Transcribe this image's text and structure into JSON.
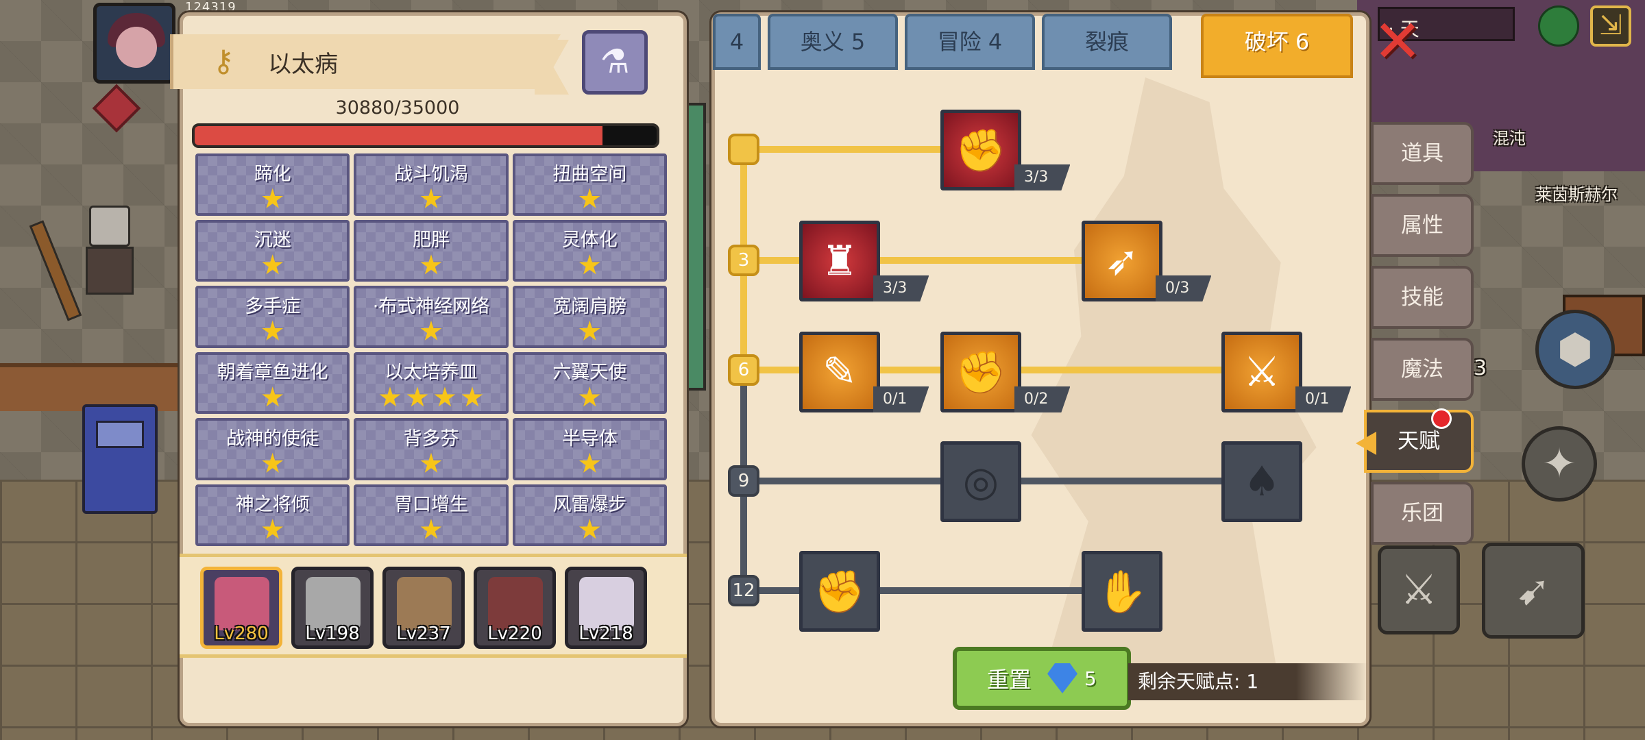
{
  "hud": {
    "stats_text": "124319",
    "top_right_name": "· 天",
    "world_labels": {
      "chaos": "混沌",
      "npc_name": "莱茵斯赫尔",
      "counter": "3"
    }
  },
  "hero": {
    "name": "以太病",
    "hp_text": "30880/35000",
    "hp_current": 30880,
    "hp_max": 35000,
    "traits": [
      {
        "name": "蹄化",
        "stars": 1
      },
      {
        "name": "战斗饥渴",
        "stars": 1
      },
      {
        "name": "扭曲空间",
        "stars": 1
      },
      {
        "name": "沉迷",
        "stars": 1
      },
      {
        "name": "肥胖",
        "stars": 1
      },
      {
        "name": "灵体化",
        "stars": 1
      },
      {
        "name": "多手症",
        "stars": 1
      },
      {
        "name": "·布式神经网络",
        "stars": 1
      },
      {
        "name": "宽阔肩膀",
        "stars": 1
      },
      {
        "name": "朝着章鱼进化",
        "stars": 1
      },
      {
        "name": "以太培养皿",
        "stars": 4
      },
      {
        "name": "六翼天使",
        "stars": 1
      },
      {
        "name": "战神的使徒",
        "stars": 1
      },
      {
        "name": "背多芬",
        "stars": 1
      },
      {
        "name": "半导体",
        "stars": 1
      },
      {
        "name": "神之将倾",
        "stars": 1
      },
      {
        "name": "胃口增生",
        "stars": 1
      },
      {
        "name": "风雷爆步",
        "stars": 1
      }
    ],
    "roster": [
      {
        "level": "Lv280",
        "selected": true,
        "color": "#c85a7a"
      },
      {
        "level": "Lv198",
        "selected": false,
        "color": "#a8a8a8"
      },
      {
        "level": "Lv237",
        "selected": false,
        "color": "#9c7a55"
      },
      {
        "level": "Lv220",
        "selected": false,
        "color": "#7d3b3b"
      },
      {
        "level": "Lv218",
        "selected": false,
        "color": "#d8cfe0"
      }
    ]
  },
  "talent": {
    "tabs": [
      {
        "label": "4",
        "active": false
      },
      {
        "label": "奥义 5",
        "active": false
      },
      {
        "label": "冒险 4",
        "active": false
      },
      {
        "label": "裂痕",
        "active": false
      },
      {
        "label": "破坏 6",
        "active": true
      }
    ],
    "tiers": [
      "",
      "3",
      "6",
      "9",
      "12"
    ],
    "skills": [
      {
        "icon": "arm-wrestle-icon",
        "glyph": "✊",
        "style": "red",
        "count": "3/3"
      },
      {
        "icon": "muscle-body-icon",
        "glyph": "♜",
        "style": "red",
        "count": "3/3"
      },
      {
        "icon": "arrow-strike-icon",
        "glyph": "➶",
        "style": "orange",
        "count": "0/3"
      },
      {
        "icon": "scroll-slash-icon",
        "glyph": "✎",
        "style": "orange",
        "count": "0/1"
      },
      {
        "icon": "fist-punch-icon",
        "glyph": "✊",
        "style": "orange",
        "count": "0/2"
      },
      {
        "icon": "blood-slash-icon",
        "glyph": "⚔",
        "style": "orange",
        "count": "0/1"
      },
      {
        "icon": "vortex-icon",
        "glyph": "◎",
        "style": "locked",
        "count": ""
      },
      {
        "icon": "bat-wings-icon",
        "glyph": "♠",
        "style": "locked",
        "count": ""
      },
      {
        "icon": "raised-fist-icon",
        "glyph": "✊",
        "style": "locked",
        "count": ""
      },
      {
        "icon": "hand-grip-icon",
        "glyph": "✋",
        "style": "locked",
        "count": ""
      }
    ],
    "reset_label": "重置",
    "reset_cost": "5",
    "remaining_label": "剩余天赋点:",
    "remaining_points": "1"
  },
  "menu": [
    {
      "label": "道具",
      "active": false
    },
    {
      "label": "属性",
      "active": false
    },
    {
      "label": "技能",
      "active": false
    },
    {
      "label": "魔法",
      "active": false
    },
    {
      "label": "天赋",
      "active": true
    },
    {
      "label": "乐团",
      "active": false
    }
  ],
  "colors": {
    "hp_fill": "#dc4b43",
    "active_tab": "#f2ad2b",
    "tree_gold": "#f1c346",
    "tree_locked": "#4f5662",
    "star": "#f7c518"
  }
}
